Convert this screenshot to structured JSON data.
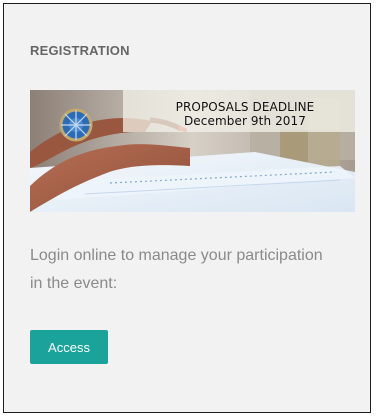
{
  "sidebar_widget": {
    "title": "REGISTRATION",
    "banner": {
      "line1": "PROPOSALS DEADLINE",
      "line2": "December 9th 2017"
    },
    "description": "Login online to manage your participation in the event:",
    "access_button_label": "Access"
  },
  "colors": {
    "panel_background": "#f2f2f2",
    "panel_border": "#1f1f1f",
    "heading_text": "#666666",
    "description_text": "#8a8a8a",
    "button_background": "#1aa39b",
    "button_text": "#ffffff"
  }
}
